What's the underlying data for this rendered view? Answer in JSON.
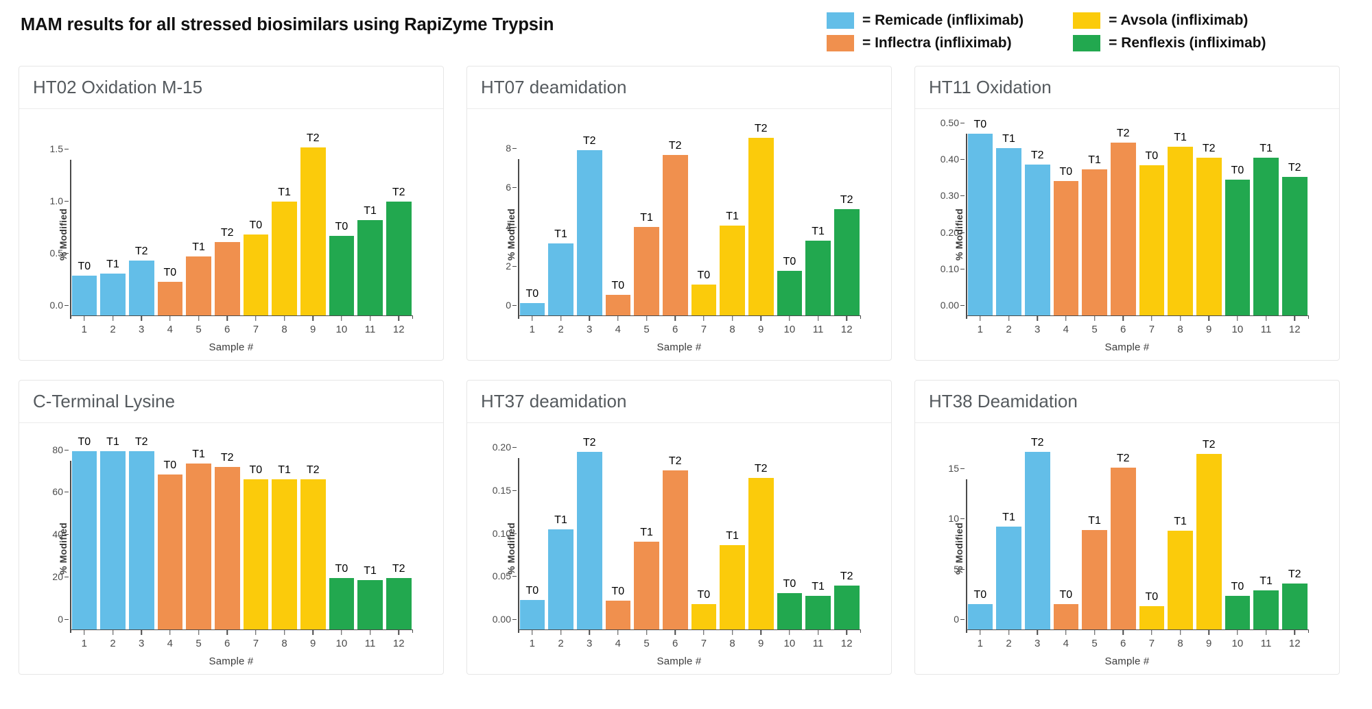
{
  "header": {
    "title": "MAM results for all stressed biosimilars using RapiZyme Trypsin"
  },
  "legend": {
    "items": [
      {
        "label": "= Remicade (infliximab)",
        "color": "#63BEE8",
        "name": "remicade"
      },
      {
        "label": "= Avsola  (infliximab)",
        "color": "#FBCB0B",
        "name": "avsola"
      },
      {
        "label": "= Inflectra (infliximab)",
        "color": "#F0904E",
        "name": "inflectra"
      },
      {
        "label": "= Renflexis (infliximab)",
        "color": "#22A84F",
        "name": "renflexis"
      }
    ]
  },
  "colors": {
    "remicade": "#63BEE8",
    "inflectra": "#F0904E",
    "avsola": "#FBCB0B",
    "renflexis": "#22A84F"
  },
  "bar_colors": [
    "#63BEE8",
    "#63BEE8",
    "#63BEE8",
    "#F0904E",
    "#F0904E",
    "#F0904E",
    "#FBCB0B",
    "#FBCB0B",
    "#FBCB0B",
    "#22A84F",
    "#22A84F",
    "#22A84F"
  ],
  "bar_labels": [
    "T0",
    "T1",
    "T2",
    "T0",
    "T1",
    "T2",
    "T0",
    "T1",
    "T2",
    "T0",
    "T1",
    "T2"
  ],
  "chart_data": [
    {
      "type": "bar",
      "title": "HT02 Oxidation M-15",
      "xlabel": "Sample #",
      "ylabel": "% Modified",
      "categories": [
        "1",
        "2",
        "3",
        "4",
        "5",
        "6",
        "7",
        "8",
        "9",
        "10",
        "11",
        "12"
      ],
      "point_labels": [
        "T0",
        "T1",
        "T2",
        "T0",
        "T1",
        "T2",
        "T0",
        "T1",
        "T2",
        "T0",
        "T1",
        "T2"
      ],
      "values": [
        0.39,
        0.41,
        0.53,
        0.33,
        0.57,
        0.71,
        0.78,
        1.1,
        1.62,
        0.77,
        0.92,
        1.1
      ],
      "yticks": [
        0.0,
        0.5,
        1.0,
        1.5
      ],
      "ytick_labels": [
        "0.0",
        "0.5",
        "1.0",
        "1.5"
      ],
      "ylim": [
        0,
        1.75
      ],
      "grid": false
    },
    {
      "type": "bar",
      "title": "HT07 deamidation",
      "xlabel": "Sample #",
      "ylabel": "% Modified",
      "categories": [
        "1",
        "2",
        "3",
        "4",
        "5",
        "6",
        "7",
        "8",
        "9",
        "10",
        "11",
        "12"
      ],
      "point_labels": [
        "T0",
        "T1",
        "T2",
        "T0",
        "T1",
        "T2",
        "T0",
        "T1",
        "T2",
        "T0",
        "T1",
        "T2"
      ],
      "values": [
        0.65,
        3.7,
        8.45,
        1.1,
        4.55,
        8.2,
        1.6,
        4.6,
        9.1,
        2.3,
        3.85,
        5.45
      ],
      "yticks": [
        0,
        2,
        4,
        6,
        8
      ],
      "ytick_labels": [
        "0",
        "2",
        "4",
        "6",
        "8"
      ],
      "ylim": [
        0,
        9.3
      ],
      "grid": false
    },
    {
      "type": "bar",
      "title": "HT11 Oxidation",
      "xlabel": "Sample #",
      "ylabel": "% Modified",
      "categories": [
        "1",
        "2",
        "3",
        "4",
        "5",
        "6",
        "7",
        "8",
        "9",
        "10",
        "11",
        "12"
      ],
      "point_labels": [
        "T0",
        "T1",
        "T2",
        "T0",
        "T1",
        "T2",
        "T0",
        "T1",
        "T2",
        "T0",
        "T1",
        "T2"
      ],
      "values": [
        0.5,
        0.46,
        0.415,
        0.37,
        0.402,
        0.475,
        0.414,
        0.465,
        0.435,
        0.375,
        0.435,
        0.381
      ],
      "yticks": [
        0.0,
        0.1,
        0.2,
        0.3,
        0.4,
        0.5
      ],
      "ytick_labels": [
        "0.00",
        "0.10",
        "0.20",
        "0.30",
        "0.40",
        "0.50"
      ],
      "ylim": [
        0,
        0.5
      ],
      "grid": false
    },
    {
      "type": "bar",
      "title": "C-Terminal Lysine",
      "xlabel": "Sample #",
      "ylabel": "% Modified",
      "categories": [
        "1",
        "2",
        "3",
        "4",
        "5",
        "6",
        "7",
        "8",
        "9",
        "10",
        "11",
        "12"
      ],
      "point_labels": [
        "T0",
        "T1",
        "T2",
        "T0",
        "T1",
        "T2",
        "T0",
        "T1",
        "T2",
        "T0",
        "T1",
        "T2"
      ],
      "values": [
        84.5,
        84.5,
        84.5,
        73.5,
        78.5,
        77.0,
        71.0,
        71.0,
        71.0,
        24.5,
        23.5,
        24.5
      ],
      "yticks": [
        0,
        20,
        40,
        60,
        80
      ],
      "ytick_labels": [
        "0",
        "20",
        "40",
        "60",
        "80"
      ],
      "ylim": [
        0,
        86
      ],
      "grid": false
    },
    {
      "type": "bar",
      "title": "HT37 deamidation",
      "xlabel": "Sample #",
      "ylabel": "% Modified",
      "categories": [
        "1",
        "2",
        "3",
        "4",
        "5",
        "6",
        "7",
        "8",
        "9",
        "10",
        "11",
        "12"
      ],
      "point_labels": [
        "T0",
        "T1",
        "T2",
        "T0",
        "T1",
        "T2",
        "T0",
        "T1",
        "T2",
        "T0",
        "T1",
        "T2"
      ],
      "values": [
        0.035,
        0.117,
        0.207,
        0.034,
        0.103,
        0.186,
        0.03,
        0.099,
        0.177,
        0.043,
        0.04,
        0.052
      ],
      "yticks": [
        0.0,
        0.05,
        0.1,
        0.15,
        0.2
      ],
      "ytick_labels": [
        "0.00",
        "0.05",
        "0.10",
        "0.15",
        "0.20"
      ],
      "ylim": [
        0,
        0.212
      ],
      "grid": false
    },
    {
      "type": "bar",
      "title": "HT38 Deamidation",
      "xlabel": "Sample #",
      "ylabel": "% Modified",
      "categories": [
        "1",
        "2",
        "3",
        "4",
        "5",
        "6",
        "7",
        "8",
        "9",
        "10",
        "11",
        "12"
      ],
      "point_labels": [
        "T0",
        "T1",
        "T2",
        "T0",
        "T1",
        "T2",
        "T0",
        "T1",
        "T2",
        "T0",
        "T1",
        "T2"
      ],
      "values": [
        2.6,
        10.3,
        17.7,
        2.6,
        9.95,
        16.1,
        2.4,
        9.9,
        17.5,
        3.4,
        3.95,
        4.6
      ],
      "yticks": [
        0,
        5,
        10,
        15
      ],
      "ytick_labels": [
        "0",
        "5",
        "10",
        "15"
      ],
      "ylim": [
        0,
        18.1
      ],
      "grid": false
    }
  ]
}
